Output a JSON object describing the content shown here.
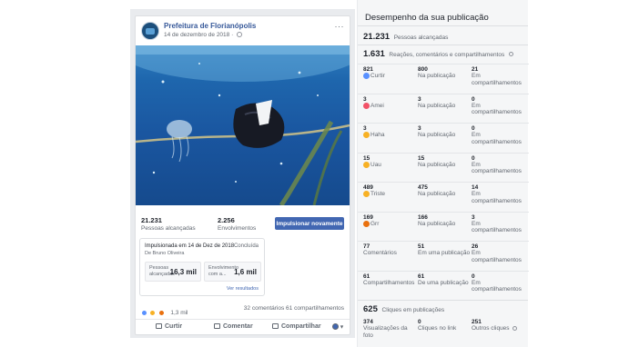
{
  "post": {
    "page_name": "Prefeitura de Florianópolis",
    "date": "14 de dezembro de 2018",
    "options_glyph": "···",
    "stats": {
      "reach_value": "21.231",
      "reach_label": "Pessoas alcançadas",
      "engagement_value": "2.256",
      "engagement_label": "Envolvimentos",
      "boost_button": "Impulsionar novamente"
    },
    "boost": {
      "title": "Impulsionada em 14 de Dez de 2018",
      "status": "Concluída",
      "author": "De Bruno Oliveira",
      "reach_label": "Pessoas alcançadas",
      "reach_value": "16,3 mil",
      "engagement_label": "Envolvimento com a...",
      "engagement_value": "1,6 mil",
      "results_link": "Ver resultados"
    },
    "reactions_summary": "1,3 mil",
    "comments_shares": "32 comentários  61 compartilhamentos",
    "actions": {
      "like": "Curtir",
      "comment": "Comentar",
      "share": "Compartilhar"
    }
  },
  "performance": {
    "title": "Desempenho da sua publicação",
    "reached_value": "21.231",
    "reached_label": "Pessoas alcançadas",
    "reactions_value": "1.631",
    "reactions_label": "Reações, comentários e compartilhamentos",
    "rows": [
      {
        "icon": "like-icon",
        "color": "#5890ff",
        "total": "821",
        "label": "Curtir",
        "post": "800",
        "post_label": "Na publicação",
        "shares": "21",
        "shares_label": "Em compartilhamentos"
      },
      {
        "icon": "love-icon",
        "color": "#f25268",
        "total": "3",
        "label": "Amei",
        "post": "3",
        "post_label": "Na publicação",
        "shares": "0",
        "shares_label": "Em compartilhamentos"
      },
      {
        "icon": "haha-icon",
        "color": "#f7b125",
        "total": "3",
        "label": "Haha",
        "post": "3",
        "post_label": "Na publicação",
        "shares": "0",
        "shares_label": "Em compartilhamentos"
      },
      {
        "icon": "wow-icon",
        "color": "#f7b125",
        "total": "15",
        "label": "Uau",
        "post": "15",
        "post_label": "Na publicação",
        "shares": "0",
        "shares_label": "Em compartilhamentos"
      },
      {
        "icon": "sad-icon",
        "color": "#f7b125",
        "total": "489",
        "label": "Triste",
        "post": "475",
        "post_label": "Na publicação",
        "shares": "14",
        "shares_label": "Em compartilhamentos"
      },
      {
        "icon": "angry-icon",
        "color": "#e9710f",
        "total": "169",
        "label": "Grr",
        "post": "166",
        "post_label": "Na publicação",
        "shares": "3",
        "shares_label": "Em compartilhamentos"
      },
      {
        "icon": "",
        "color": "",
        "total": "77",
        "label": "Comentários",
        "post": "51",
        "post_label": "Em uma publicação",
        "shares": "26",
        "shares_label": "Em compartilhamentos"
      },
      {
        "icon": "",
        "color": "",
        "total": "61",
        "label": "Compartilhamentos",
        "post": "61",
        "post_label": "De uma publicação",
        "shares": "0",
        "shares_label": "Em compartilhamentos"
      }
    ],
    "clicks_value": "625",
    "clicks_label": "Cliques em publicações",
    "clicks": [
      {
        "value": "374",
        "label": "Visualizações da foto"
      },
      {
        "value": "0",
        "label": "Cliques no link"
      },
      {
        "value": "251",
        "label": "Outros cliques"
      }
    ]
  }
}
